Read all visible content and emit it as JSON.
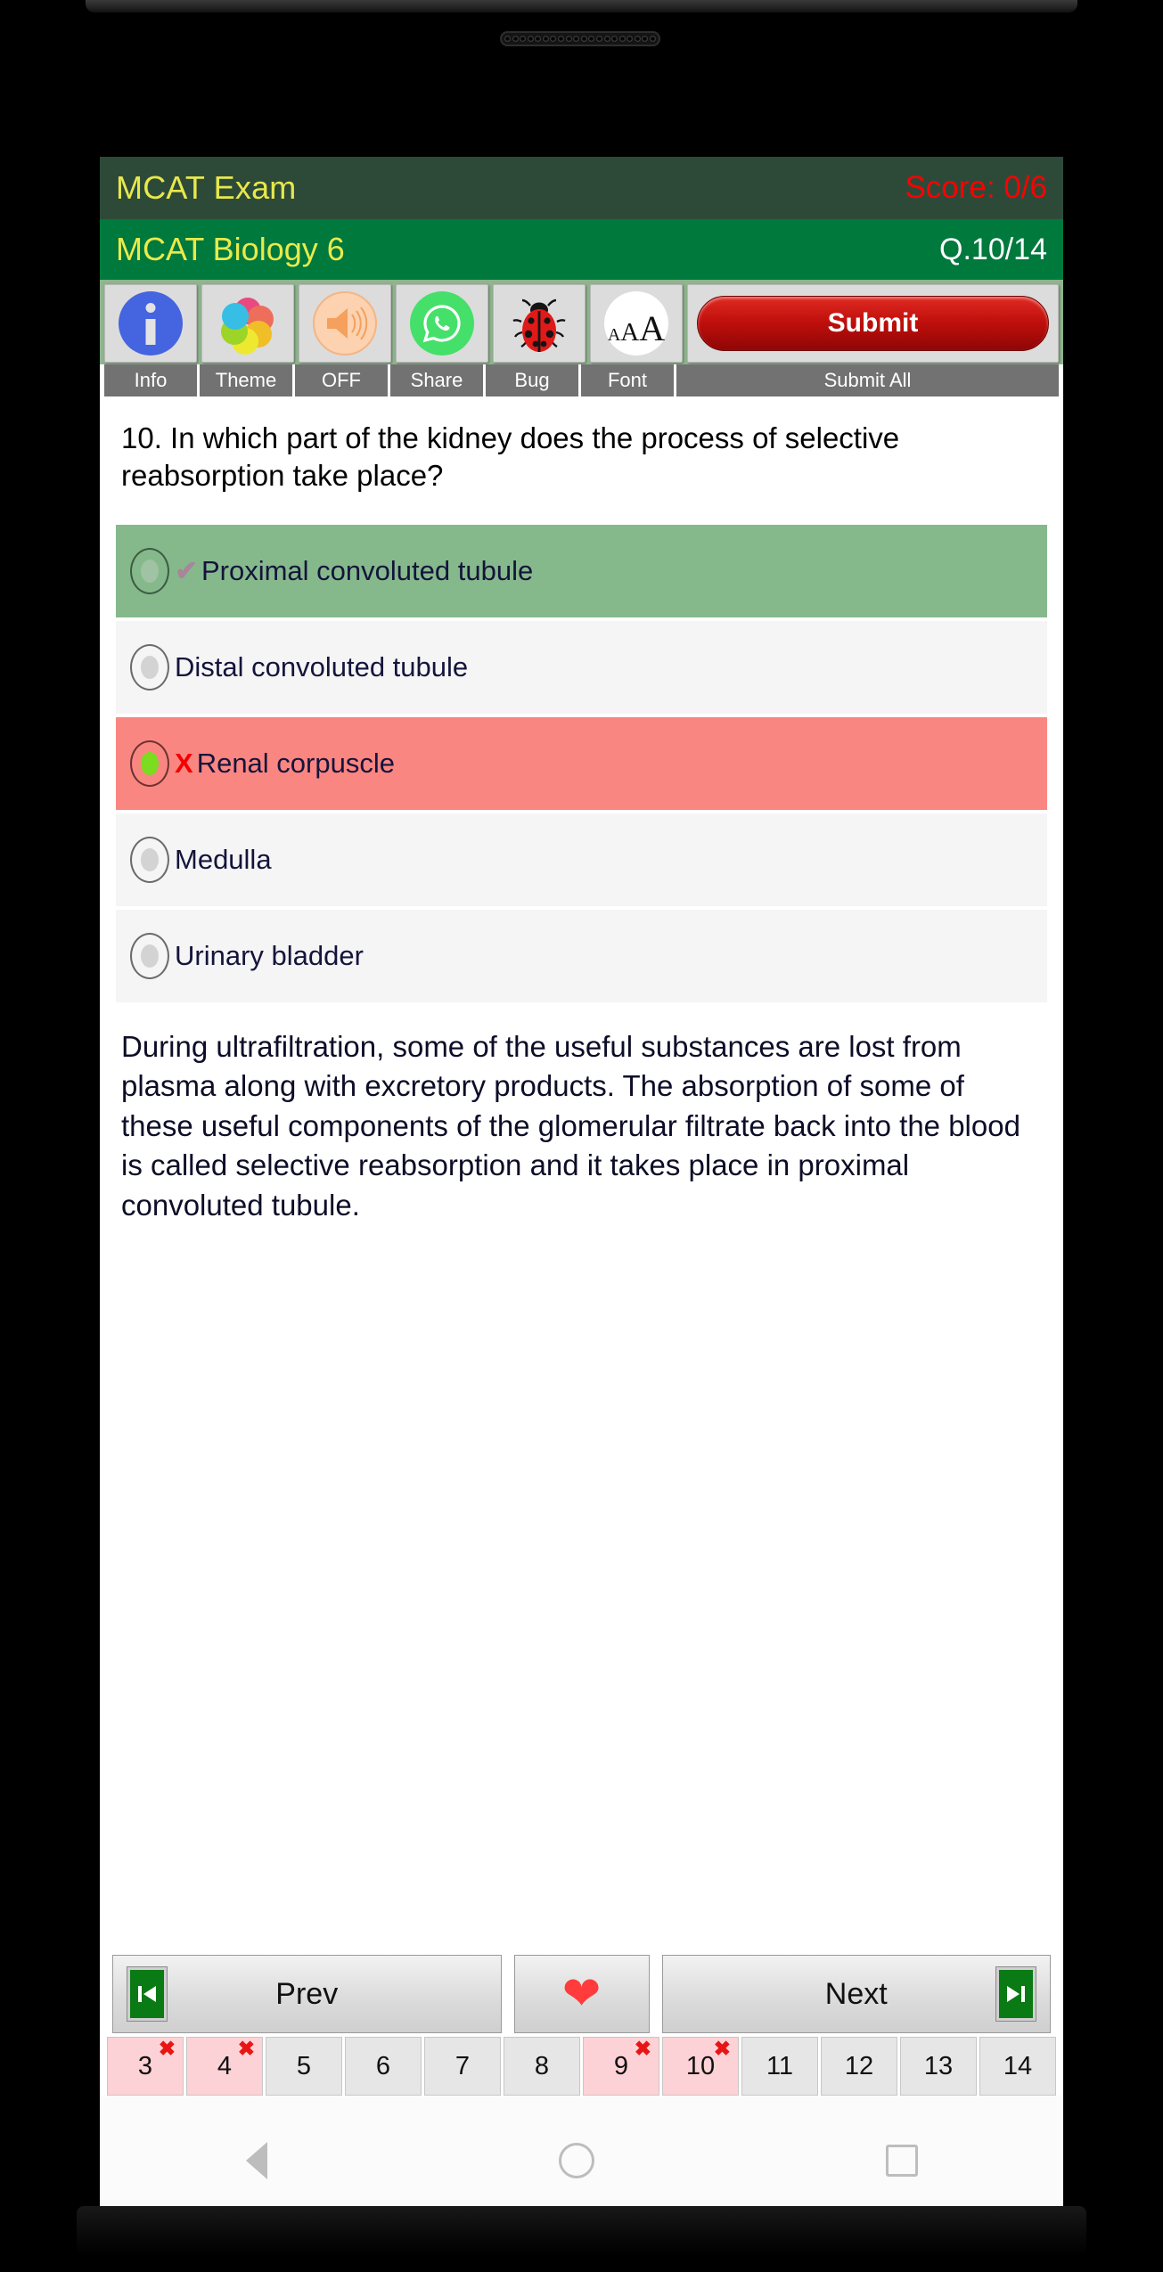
{
  "app": {
    "title": "MCAT Exam",
    "score": "Score: 0/6",
    "subject": "MCAT Biology 6",
    "question_counter": "Q.10/14"
  },
  "toolbar": {
    "items": [
      {
        "label": "Info",
        "icon": "info-icon"
      },
      {
        "label": "Theme",
        "icon": "color-wheel-icon"
      },
      {
        "label": "OFF",
        "icon": "speaker-icon"
      },
      {
        "label": "Share",
        "icon": "whatsapp-icon"
      },
      {
        "label": "Bug",
        "icon": "ladybug-icon"
      },
      {
        "label": "Font",
        "icon": "font-size-icon"
      },
      {
        "label": "Submit All",
        "icon": "submit-button"
      }
    ],
    "submit_label": "Submit"
  },
  "question": {
    "text": "10. In which part of the kidney does the process of selective reabsorption take place?",
    "options": [
      {
        "text": "Proximal convoluted tubule",
        "state": "correct",
        "mark": "✔",
        "selected": false
      },
      {
        "text": "Distal convoluted tubule",
        "state": "neutral",
        "mark": "",
        "selected": false
      },
      {
        "text": "Renal corpuscle",
        "state": "wrong",
        "mark": "X",
        "selected": true
      },
      {
        "text": "Medulla",
        "state": "neutral",
        "mark": "",
        "selected": false
      },
      {
        "text": "Urinary bladder",
        "state": "neutral",
        "mark": "",
        "selected": false
      }
    ],
    "explanation": "During ultrafiltration, some of the useful substances are lost from plasma along with excretory products. The absorption of some of these useful components of the glomerular filtrate back into the blood is called selective reabsorption and it takes place in proximal convoluted tubule."
  },
  "navigation": {
    "prev_label": "Prev",
    "next_label": "Next",
    "favorite_icon": "heart-icon",
    "prev_icon": "skip-previous-icon",
    "next_icon": "skip-next-icon"
  },
  "pager": {
    "pages": [
      {
        "number": "3",
        "marked": true
      },
      {
        "number": "4",
        "marked": true
      },
      {
        "number": "5",
        "marked": false
      },
      {
        "number": "6",
        "marked": false
      },
      {
        "number": "7",
        "marked": false
      },
      {
        "number": "8",
        "marked": false
      },
      {
        "number": "9",
        "marked": true
      },
      {
        "number": "10",
        "marked": true
      },
      {
        "number": "11",
        "marked": false
      },
      {
        "number": "12",
        "marked": false
      },
      {
        "number": "13",
        "marked": false
      },
      {
        "number": "14",
        "marked": false
      }
    ],
    "mark_symbol": "✖"
  },
  "system_nav": {
    "back": "back-icon",
    "home": "home-icon",
    "recents": "recents-icon"
  },
  "colors": {
    "appbar": "#2d4a39",
    "subbar": "#00793d",
    "title_text": "#e8e84a",
    "score_text": "#ff0000",
    "toolbar_bg": "#8fb48e",
    "correct": "#85b98b",
    "wrong": "#fa8682",
    "submit": "#bf0f0c"
  }
}
